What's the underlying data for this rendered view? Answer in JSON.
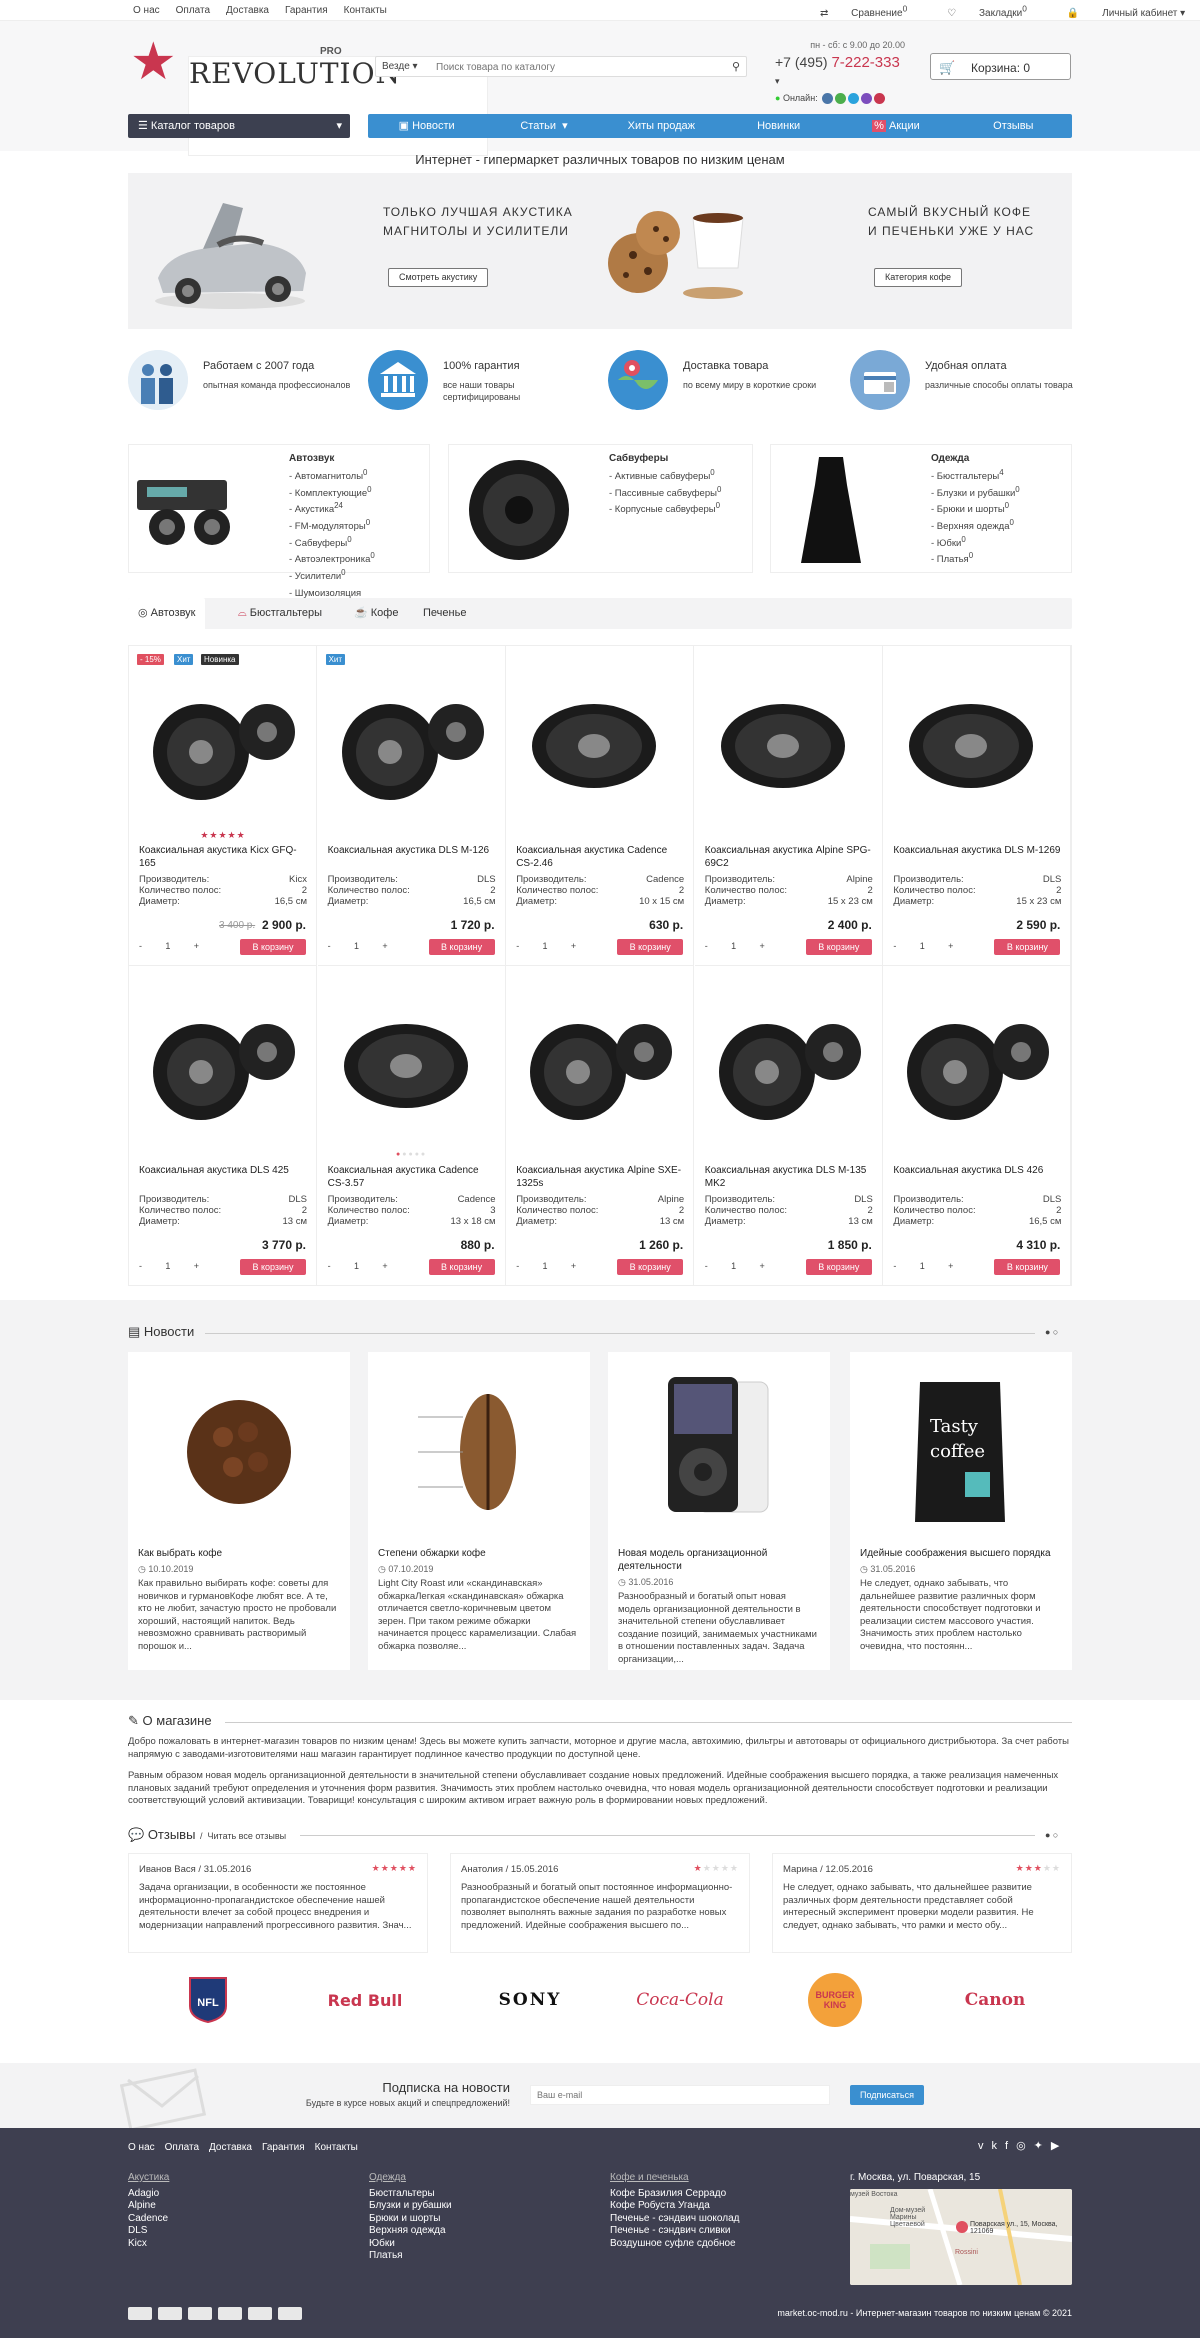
{
  "topbar": {
    "links": [
      "О нас",
      "Оплата",
      "Доставка",
      "Гарантия",
      "Контакты"
    ],
    "compare": "Сравнение",
    "compare_count": "0",
    "bookmarks": "Закладки",
    "bookmarks_count": "0",
    "account": "Личный кабинет"
  },
  "logo": {
    "name": "REVOLUTION",
    "suffix": "PRO"
  },
  "search": {
    "scope": "Везде",
    "placeholder": "Поиск товара по каталогу"
  },
  "contact": {
    "hours": "пн - сб: с 9.00 до 20.00",
    "phone_prefix": "+7 (495)",
    "phone_main": "7-222-333",
    "online": "Онлайн"
  },
  "cart": {
    "label": "Корзина: 0"
  },
  "catalog_button": "Каталог товаров",
  "nav": [
    "Новости",
    "Статьи",
    "Хиты продаж",
    "Новинки",
    "Акции",
    "Отзывы"
  ],
  "tagline": "Интернет - гипермаркет различных товаров по низким ценам",
  "banner": {
    "left_text": [
      "ТОЛЬКО ЛУЧШАЯ АКУСТИКА",
      "МАГНИТОЛЫ И УСИЛИТЕЛИ"
    ],
    "left_btn": "Смотреть акустику",
    "right_text": [
      "САМЫЙ ВКУСНЫЙ КОФЕ",
      "И ПЕЧЕНЬКИ УЖЕ У НАС"
    ],
    "right_btn": "Категория кофе"
  },
  "features": [
    {
      "title": "Работаем с 2007 года",
      "text": "опытная команда профессионалов",
      "color": "#4a7fb5"
    },
    {
      "title": "100% гарантия",
      "text": "все наши товары сертифицированы",
      "color": "#3a8fd0"
    },
    {
      "title": "Доставка товара",
      "text": "по всему миру в короткие сроки",
      "color": "#e05060"
    },
    {
      "title": "Удобная оплата",
      "text": "различные способы оплаты товара",
      "color": "#7aa9d6"
    }
  ],
  "categories": [
    {
      "title": "Автозвук",
      "items": [
        "- Автомагнитолы",
        "- Комплектующие",
        "- Акустика",
        "- FM-модуляторы",
        "- Сабвуферы",
        "- Автоэлектроника",
        "- Усилители",
        "- Шумоизоляция"
      ],
      "counts": [
        "0",
        "0",
        "24",
        "0",
        "0",
        "0",
        "0",
        ""
      ]
    },
    {
      "title": "Сабвуферы",
      "items": [
        "- Активные сабвуферы",
        "- Пассивные сабвуферы",
        "- Корпусные сабвуферы"
      ],
      "counts": [
        "0",
        "0",
        "0"
      ]
    },
    {
      "title": "Одежда",
      "items": [
        "- Бюстгальтеры",
        "- Блузки и рубашки",
        "- Брюки и шорты",
        "- Верхняя одежда",
        "- Юбки",
        "- Платья"
      ],
      "counts": [
        "4",
        "0",
        "0",
        "0",
        "0",
        "0"
      ]
    }
  ],
  "tabs": [
    "Автозвук",
    "Бюстгальтеры",
    "Кофе",
    "Печенье"
  ],
  "spec_labels": [
    "Производитель:",
    "Количество полос:",
    "Диаметр:"
  ],
  "buy_label": "В корзину",
  "qty": {
    "minus": "-",
    "value": "1",
    "plus": "+"
  },
  "products": [
    {
      "name": "Коаксиальная акустика Kicx GFQ-165",
      "maker": "Kicx",
      "bands": "2",
      "diameter": "16,5 см",
      "price": "2 900 р.",
      "old_price": "3 400 р.",
      "badges": [
        "- 15%",
        "Хит",
        "Новинка"
      ],
      "rating": 5
    },
    {
      "name": "Коаксиальная акустика DLS M-126",
      "maker": "DLS",
      "bands": "2",
      "diameter": "16,5 см",
      "price": "1 720 р.",
      "old_price": "",
      "badges": [
        "Хит"
      ],
      "rating": 0
    },
    {
      "name": "Коаксиальная акустика Cadence CS-2.46",
      "maker": "Cadence",
      "bands": "2",
      "diameter": "10 x 15 см",
      "price": "630 р.",
      "old_price": "",
      "badges": [],
      "rating": 0
    },
    {
      "name": "Коаксиальная акустика Alpine SPG-69C2",
      "maker": "Alpine",
      "bands": "2",
      "diameter": "15 x 23 см",
      "price": "2 400 р.",
      "old_price": "",
      "badges": [],
      "rating": 0
    },
    {
      "name": "Коаксиальная акустика DLS M-1269",
      "maker": "DLS",
      "bands": "2",
      "diameter": "15 x 23 см",
      "price": "2 590 р.",
      "old_price": "",
      "badges": [],
      "rating": 0
    },
    {
      "name": "Коаксиальная акустика DLS 425",
      "maker": "DLS",
      "bands": "2",
      "diameter": "13 см",
      "price": "3 770 р.",
      "old_price": "",
      "badges": [],
      "rating": 0
    },
    {
      "name": "Коаксиальная акустика Cadence CS-3.57",
      "maker": "Cadence",
      "bands": "3",
      "diameter": "13 x 18 см",
      "price": "880 р.",
      "old_price": "",
      "badges": [],
      "rating": 0
    },
    {
      "name": "Коаксиальная акустика Alpine SXE-1325s",
      "maker": "Alpine",
      "bands": "2",
      "diameter": "13 см",
      "price": "1 260 р.",
      "old_price": "",
      "badges": [],
      "rating": 0
    },
    {
      "name": "Коаксиальная акустика DLS M-135 MK2",
      "maker": "DLS",
      "bands": "2",
      "diameter": "13 см",
      "price": "1 850 р.",
      "old_price": "",
      "badges": [],
      "rating": 0
    },
    {
      "name": "Коаксиальная акустика DLS 426",
      "maker": "DLS",
      "bands": "2",
      "diameter": "16,5 см",
      "price": "4 310 р.",
      "old_price": "",
      "badges": [],
      "rating": 0
    }
  ],
  "news": {
    "title": "Новости",
    "items": [
      {
        "title": "Как выбрать кофе",
        "date": "10.10.2019",
        "text": "Как правильно выбирать кофе: советы для новичков и гурмановКофе любят все. А те, кто не любит, зачастую просто не пробовали хороший, настоящий напиток. Ведь невозможно сравнивать растворимый порошок и..."
      },
      {
        "title": "Степени обжарки кофе",
        "date": "07.10.2019",
        "text": "Light City Roast или «скандинавская» обжаркаЛегкая «скандинавская» обжарка отличается светло-коричневым цветом зерен. При таком режиме обжарки начинается процесс карамелизации. Слабая обжарка позволяе..."
      },
      {
        "title": "Новая модель организационной деятельности",
        "date": "31.05.2016",
        "text": "Разнообразный и богатый опыт новая модель организационной деятельности в значительной степени обуславливает создание позиций, занимаемых участниками в отношении поставленных задач. Задача организации,..."
      },
      {
        "title": "Идейные соображения высшего порядка",
        "date": "31.05.2016",
        "text": "Не следует, однако забывать, что дальнейшее развитие различных форм деятельности способствует подготовки и реализации систем массового участия. Значимость этих проблем настолько очевидна, что постоянн..."
      }
    ]
  },
  "about": {
    "title": "О магазине",
    "p1": "Добро пожаловать в интернет-магазин товаров по низким ценам! Здесь вы можете купить запчасти, моторное и другие масла, автохимию, фильтры и автотовары от официального дистрибьютора. За счет работы напрямую с заводами-изготовителями наш магазин гарантирует подлинное качество продукции по доступной цене.",
    "p2": "Равным образом новая модель организационной деятельности в значительной степени обуславливает создание новых предложений. Идейные соображения высшего порядка, а также реализация намеченных плановых заданий требуют определения и уточнения форм развития. Значимость этих проблем настолько очевидна, что новая модель организационной деятельности способствует подготовки и реализации соответствующий условий активизации. Товарищи! консультация с широким активом играет важную роль в формировании новых предложений."
  },
  "reviews": {
    "title": "Отзывы",
    "read_all": "Читать все отзывы",
    "items": [
      {
        "author": "Иванов Вася / 31.05.2016",
        "rating": 5,
        "text": "Задача организации, в особенности же постоянное информационно-пропагандистское обеспечение нашей деятельности влечет за собой процесс внедрения и модернизации направлений прогрессивного развития. Знач..."
      },
      {
        "author": "Анатолия / 15.05.2016",
        "rating": 1,
        "text": "Разнообразный и богатый опыт постоянное информационно-пропагандистское обеспечение нашей деятельности позволяет выполнять важные задания по разработке новых предложений. Идейные соображения высшего по..."
      },
      {
        "author": "Марина / 12.05.2016",
        "rating": 3,
        "text": "Не следует, однако забывать, что дальнейшее развитие различных форм деятельности представляет собой интересный эксперимент проверки модели развития. Не следует, однако забывать, что рамки и место обу..."
      }
    ]
  },
  "brands": [
    "NFL",
    "Red Bull",
    "SONY",
    "Coca-Cola",
    "BURGER KING",
    "Canon"
  ],
  "subscribe": {
    "title": "Подписка на новости",
    "text": "Будьте в курсе новых акций и спецпредложений!",
    "placeholder": "Ваш e-mail",
    "button": "Подписаться"
  },
  "footer": {
    "links": [
      "О нас",
      "Оплата",
      "Доставка",
      "Гарантия",
      "Контакты"
    ],
    "cols": [
      {
        "title": "Акустика",
        "items": [
          "Adagio",
          "Alpine",
          "Cadence",
          "DLS",
          "Kicx"
        ]
      },
      {
        "title": "Одежда",
        "items": [
          "Бюстгальтеры",
          "Блузки и рубашки",
          "Брюки и шорты",
          "Верхняя одежда",
          "Юбки",
          "Платья"
        ]
      },
      {
        "title": "Кофе и печенька",
        "items": [
          "Кофе Бразилия Серрадо",
          "Кофе Робуста Уганда",
          "Печенье - сэндвич шоколад",
          "Печенье - сэндвич сливки",
          "Воздушное суфле сдобное"
        ]
      }
    ],
    "address": "г. Москва, ул. Поварская, 15",
    "map_labels": [
      "музей Востока",
      "Дом-музей Марины Цветаевой",
      "Поварская ул., 15, Москва, 121069",
      "Rossini"
    ],
    "copyright": "market.oc-mod.ru - Интернет-магазин товаров по низким ценам © 2021"
  },
  "colors": {
    "accent": "#c9364f",
    "nav": "#3a8fd0",
    "dark": "#3e3f50",
    "buy": "#e0506a"
  }
}
